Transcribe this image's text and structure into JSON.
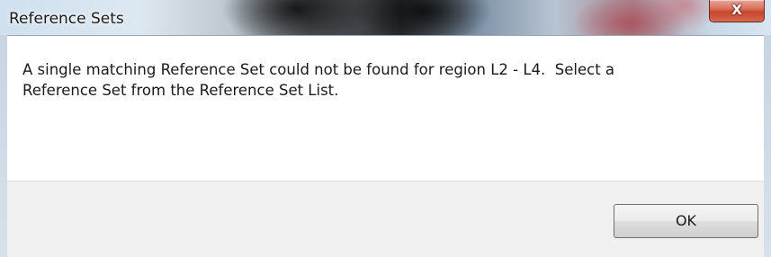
{
  "window": {
    "title": "Reference Sets",
    "close_glyph": "X"
  },
  "dialog": {
    "message_line1": "A single matching Reference Set could not be found for region L2 - L4.  Select a",
    "message_line2": "Reference Set from the Reference Set List."
  },
  "buttons": {
    "ok_label": "OK"
  },
  "icons": {
    "close": "close-icon"
  },
  "colors": {
    "close_button": "#c8452c",
    "content_bg": "#ffffff",
    "footer_bg": "#f0f0f0"
  }
}
